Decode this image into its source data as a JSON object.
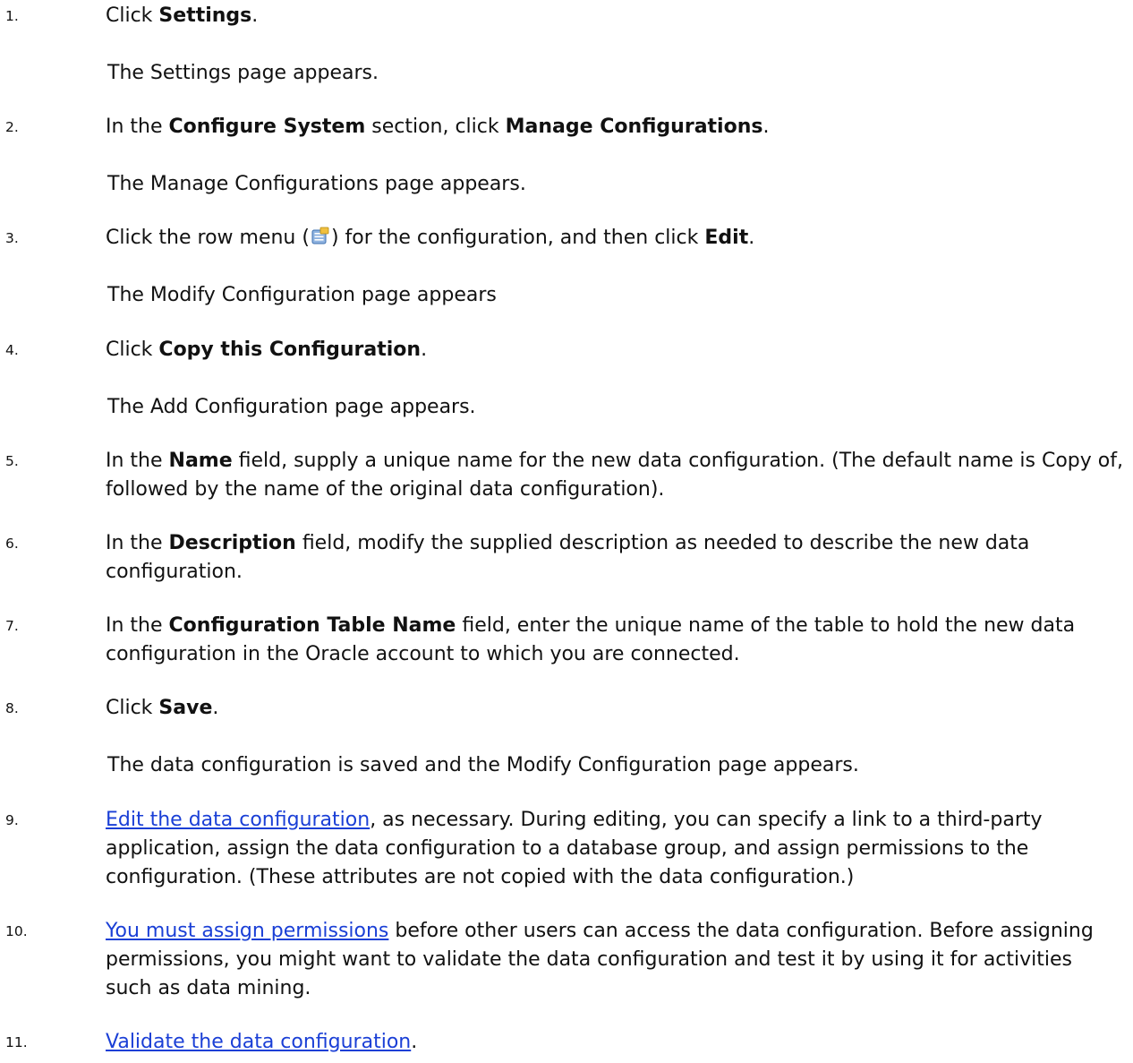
{
  "steps": [
    {
      "number": "1.",
      "parts": [
        {
          "t": "text",
          "v": "Click "
        },
        {
          "t": "bold",
          "v": "Settings"
        },
        {
          "t": "text",
          "v": "."
        }
      ],
      "result": "The Settings page appears."
    },
    {
      "number": "2.",
      "parts": [
        {
          "t": "text",
          "v": "In the "
        },
        {
          "t": "bold",
          "v": "Configure System"
        },
        {
          "t": "text",
          "v": " section, click "
        },
        {
          "t": "bold",
          "v": "Manage Configurations"
        },
        {
          "t": "text",
          "v": "."
        }
      ],
      "result": "The Manage Configurations page appears."
    },
    {
      "number": "3.",
      "parts": [
        {
          "t": "text",
          "v": "Click the row menu ("
        },
        {
          "t": "icon",
          "v": "row-menu-icon"
        },
        {
          "t": "text",
          "v": ") for the configuration, and then click "
        },
        {
          "t": "bold",
          "v": "Edit"
        },
        {
          "t": "text",
          "v": "."
        }
      ],
      "result": "The Modify Configuration page appears"
    },
    {
      "number": "4.",
      "parts": [
        {
          "t": "text",
          "v": "Click "
        },
        {
          "t": "bold",
          "v": "Copy this Configuration"
        },
        {
          "t": "text",
          "v": "."
        }
      ],
      "result": "The Add Configuration page appears."
    },
    {
      "number": "5.",
      "parts": [
        {
          "t": "text",
          "v": "In the "
        },
        {
          "t": "bold",
          "v": "Name"
        },
        {
          "t": "text",
          "v": " field, supply a unique name for the new data configuration. (The default name is Copy of, followed by the name of the original data configuration)."
        }
      ]
    },
    {
      "number": "6.",
      "parts": [
        {
          "t": "text",
          "v": "In the "
        },
        {
          "t": "bold",
          "v": "Description"
        },
        {
          "t": "text",
          "v": " field, modify the supplied description as needed to describe the new data configuration."
        }
      ]
    },
    {
      "number": "7.",
      "parts": [
        {
          "t": "text",
          "v": "In the "
        },
        {
          "t": "bold",
          "v": "Configuration Table Name"
        },
        {
          "t": "text",
          "v": " field, enter the unique name of the table to hold the new data configuration in the Oracle account to which you are connected."
        }
      ]
    },
    {
      "number": "8.",
      "parts": [
        {
          "t": "text",
          "v": "Click "
        },
        {
          "t": "bold",
          "v": "Save"
        },
        {
          "t": "text",
          "v": "."
        }
      ],
      "result": "The data configuration is saved and the Modify Configuration page appears."
    },
    {
      "number": "9.",
      "parts": [
        {
          "t": "link",
          "v": "Edit the data configuration"
        },
        {
          "t": "text",
          "v": ", as necessary. During editing, you can specify a link to a third-party application, assign the data configuration to a database group, and assign permissions to the configuration. (These attributes are not copied with the data configuration.)"
        }
      ]
    },
    {
      "number": "10.",
      "parts": [
        {
          "t": "link",
          "v": "You must assign permissions"
        },
        {
          "t": "text",
          "v": " before other users can access the data configuration. Before assigning permissions, you might want to validate the data configuration and test it by using it for activities such as data mining."
        }
      ]
    },
    {
      "number": "11.",
      "parts": [
        {
          "t": "link",
          "v": "Validate the data configuration"
        },
        {
          "t": "text",
          "v": "."
        }
      ]
    }
  ],
  "colors": {
    "text": "#111111",
    "link": "#1a3fd6"
  }
}
